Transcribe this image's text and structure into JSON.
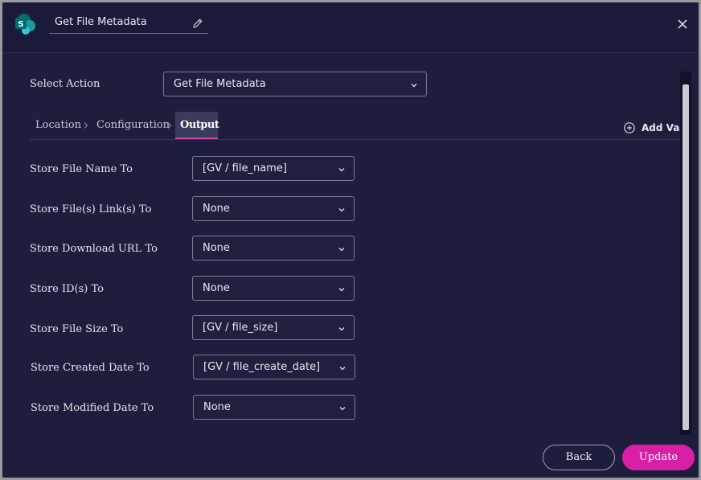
{
  "header": {
    "title": "Get File Metadata",
    "logo_icon": "sharepoint-logo",
    "edit_icon": "pencil-icon",
    "close_icon": "close-icon"
  },
  "select_action": {
    "label": "Select Action",
    "value": "Get File Metadata"
  },
  "tabs": [
    {
      "label": "Location",
      "active": false
    },
    {
      "label": "Configuration",
      "active": false
    },
    {
      "label": "Output",
      "active": true
    }
  ],
  "add_var": {
    "label": "Add Var",
    "icon": "plus-circle-icon"
  },
  "fields": [
    {
      "label": "Store File Name To",
      "value": "[GV / file_name]"
    },
    {
      "label": "Store File(s) Link(s) To",
      "value": "None"
    },
    {
      "label": "Store Download URL To",
      "value": "None"
    },
    {
      "label": "Store ID(s) To",
      "value": "None"
    },
    {
      "label": "Store File Size To",
      "value": "[GV / file_size]"
    },
    {
      "label": "Store Created Date To",
      "value": "[GV / file_create_date]"
    },
    {
      "label": "Store Modified Date To",
      "value": "None"
    }
  ],
  "footer": {
    "back_label": "Back",
    "update_label": "Update"
  },
  "colors": {
    "background": "#1c1e3c",
    "accent": "#d81fa6",
    "tab_underline": "#d23ca9"
  }
}
